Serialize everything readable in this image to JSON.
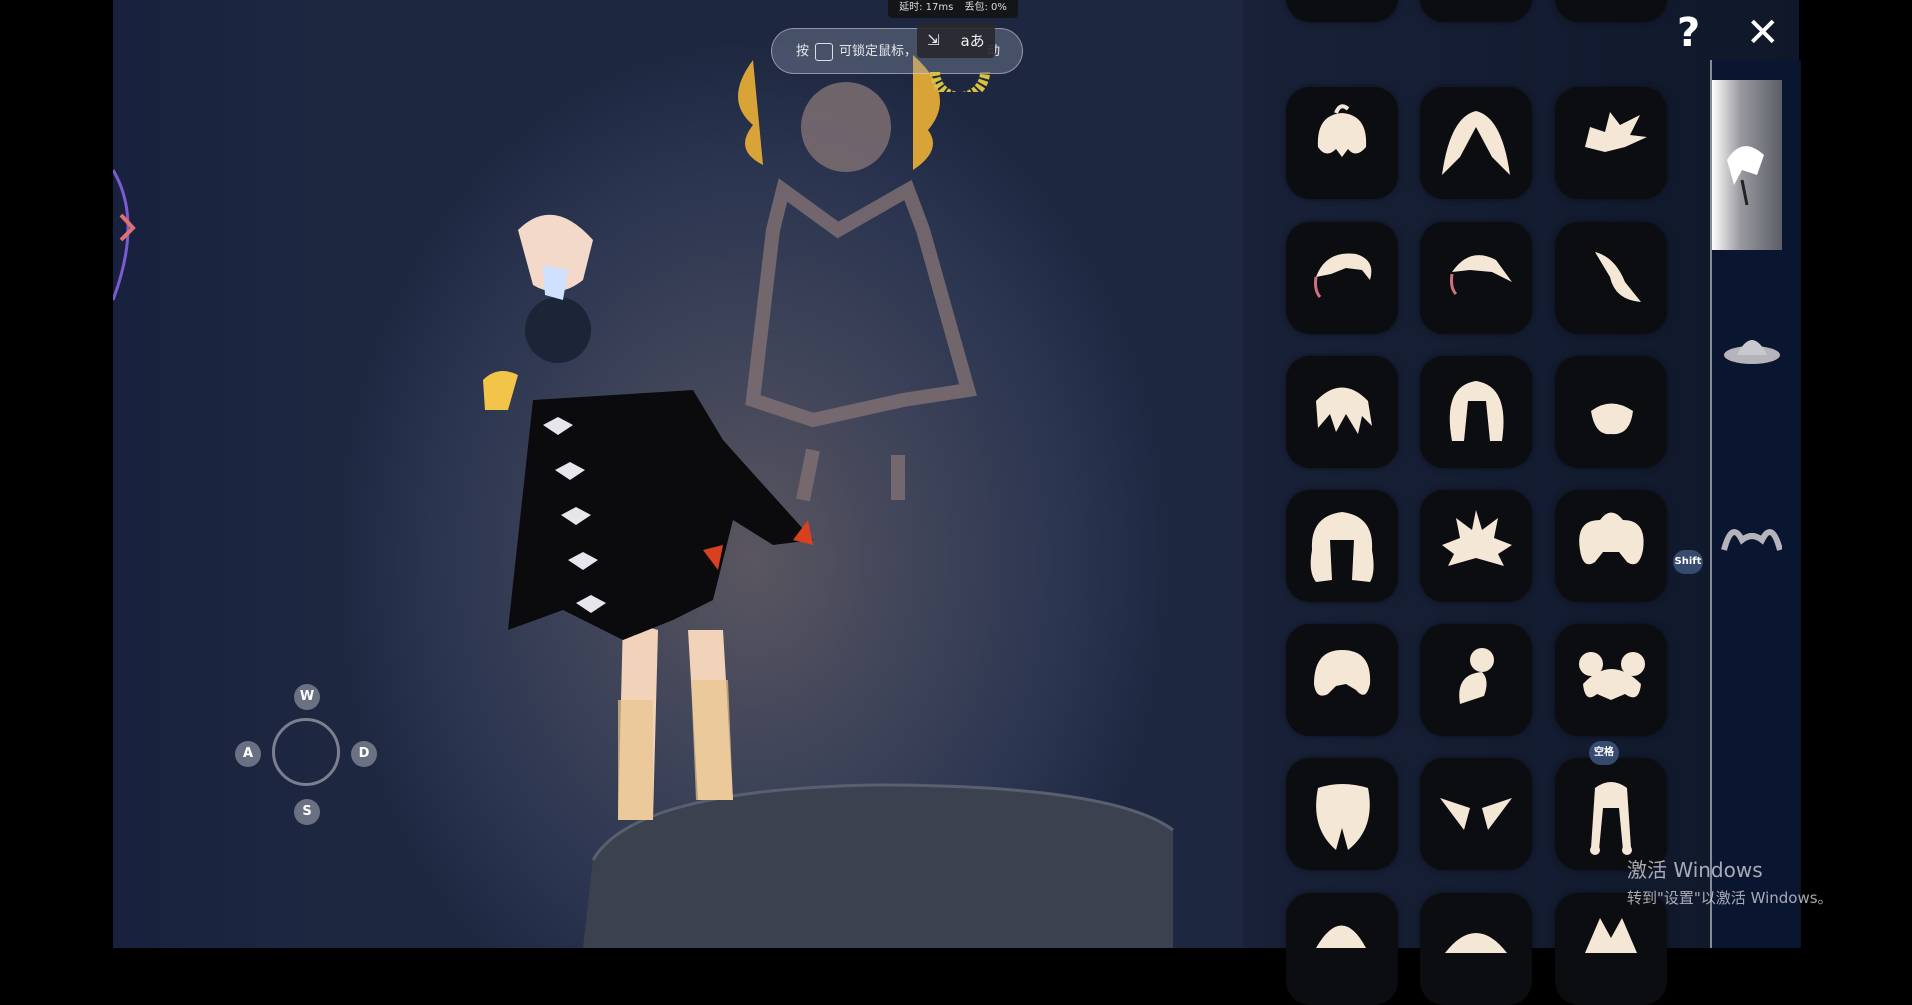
{
  "stats": {
    "latency": "延时: 17ms",
    "loss": "丢包: 0%"
  },
  "lockbar": {
    "prefix": "按",
    "text": "可锁定鼠标，",
    "suffix": "动"
  },
  "popup": {
    "translate": "aあ",
    "screen": "⇲"
  },
  "wasd": {
    "up": "W",
    "left": "A",
    "right": "D",
    "down": "S"
  },
  "top_buttons": {
    "help": "?",
    "close": "✕"
  },
  "hints": {
    "shift": "Shift",
    "space": "空格"
  },
  "sidebar": {
    "tabs": [
      {
        "icon": "hair-icon",
        "active": true
      },
      {
        "icon": "hat-icon",
        "active": false
      },
      {
        "icon": "horns-icon",
        "active": false
      }
    ]
  },
  "hair_grid": [
    [
      "hair-short-bob-icon",
      "hair-long-straight-icon",
      "hair-spiky-icon"
    ],
    [
      "hair-swept-pink-icon",
      "hair-sidepart-pink-icon",
      "hair-tail-icon"
    ],
    [
      "hair-messy-icon",
      "hair-long-bob-icon",
      "hair-tiny-icon"
    ],
    [
      "hair-long-wavy-icon",
      "hair-spiked-crown-icon",
      "hair-fluffy-icon"
    ],
    [
      "hair-round-icon",
      "hair-bun-icon",
      "hair-twin-buns-icon"
    ],
    [
      "hair-split-icon",
      "hair-wings-icon",
      "hair-braids-icon"
    ]
  ],
  "watermark": {
    "title": "激活 Windows",
    "subtitle": "转到\"设置\"以激活 Windows。"
  }
}
